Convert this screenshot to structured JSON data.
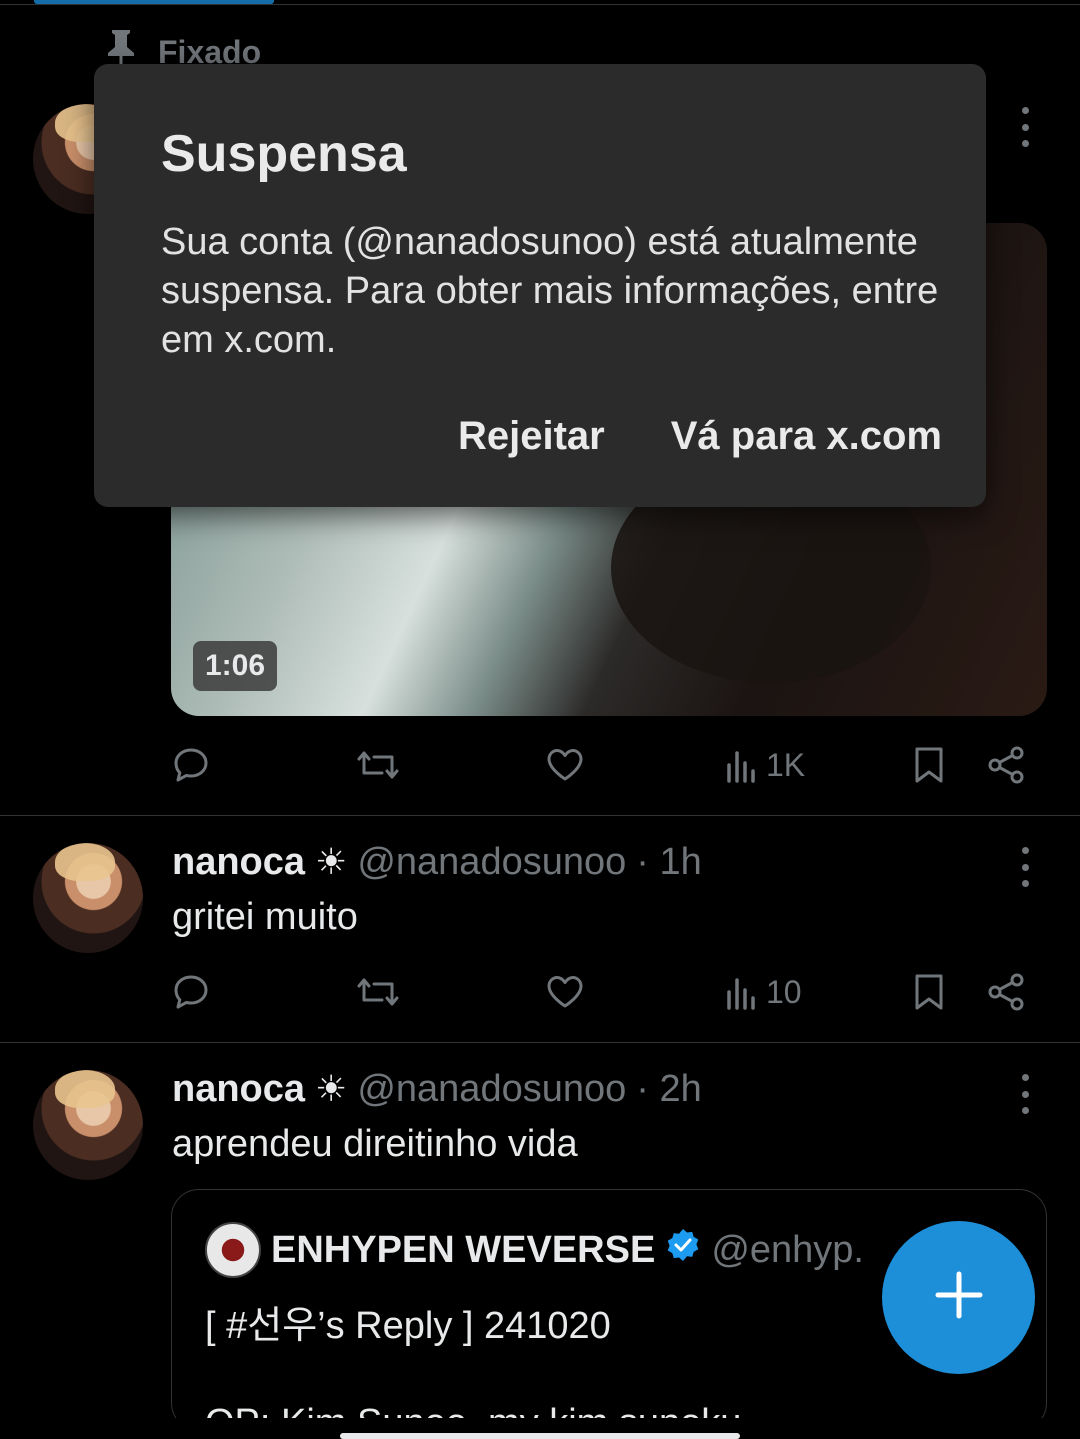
{
  "pinned": {
    "label": "Fixado",
    "icon": "pin-icon"
  },
  "video": {
    "duration": "1:06"
  },
  "pinned_tweet_actions": {
    "views": "1K"
  },
  "tweets": [
    {
      "name": "nanoca",
      "badge": "☀",
      "handle": "@nanadosunoo",
      "time": "· 1h",
      "text": "gritei muito",
      "views": "10"
    },
    {
      "name": "nanoca",
      "badge": "☀",
      "handle": "@nanadosunoo",
      "time": "· 2h",
      "text": "aprendeu direitinho vida"
    }
  ],
  "quote": {
    "name": "ENHYPEN WEVERSE",
    "handle": "@enhyp.",
    "text": "[ #선우’s Reply ] 241020",
    "text2": "OP: Kim Sunoo, my kim sunoku"
  },
  "dialog": {
    "title": "Suspensa",
    "message": "Sua conta (@nanadosunoo) está atualmente suspensa. Para obter mais informações, entre em x.com.",
    "dismiss_label": "Rejeitar",
    "confirm_label": "Vá para x.com"
  },
  "colors": {
    "background": "#000000",
    "dialog": "#2b2b2b",
    "accent": "#1d9bf0",
    "muted": "#71767b",
    "verified": "#1d9bf0"
  }
}
